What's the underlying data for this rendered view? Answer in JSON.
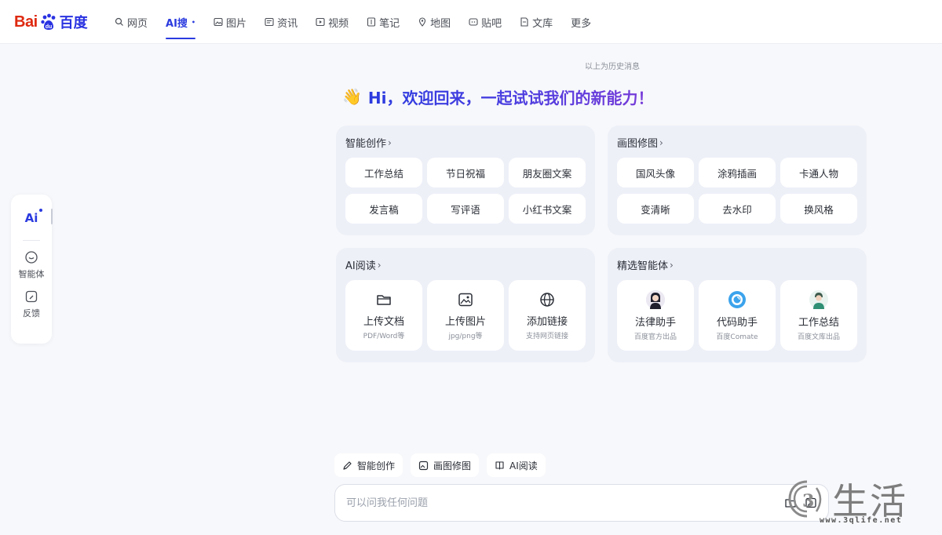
{
  "logo": {
    "left": "Bai",
    "right": "百度"
  },
  "nav": [
    {
      "label": "网页",
      "icon": "search-icon"
    },
    {
      "label": "AI搜",
      "icon": "",
      "sup": "•",
      "active": true
    },
    {
      "label": "图片",
      "icon": "image-icon"
    },
    {
      "label": "资讯",
      "icon": "news-icon"
    },
    {
      "label": "视频",
      "icon": "video-icon"
    },
    {
      "label": "笔记",
      "icon": "note-icon"
    },
    {
      "label": "地图",
      "icon": "map-icon"
    },
    {
      "label": "贴吧",
      "icon": "tieba-icon"
    },
    {
      "label": "文库",
      "icon": "doc-icon"
    },
    {
      "label": "更多",
      "icon": ""
    }
  ],
  "rail": {
    "ai_label": "Ai",
    "agents_label": "智能体",
    "feedback_label": "反馈"
  },
  "history_link": "以上为历史消息",
  "greeting": {
    "emoji": "👋",
    "text": "Hi，欢迎回来，一起试试我们的新能力！"
  },
  "panels": {
    "creation": {
      "title": "智能创作",
      "items": [
        "工作总结",
        "节日祝福",
        "朋友圈文案",
        "发言稿",
        "写评语",
        "小红书文案"
      ]
    },
    "drawing": {
      "title": "画图修图",
      "items": [
        "国风头像",
        "涂鸦插画",
        "卡通人物",
        "变清晰",
        "去水印",
        "换风格"
      ]
    },
    "reading": {
      "title": "AI阅读",
      "cards": [
        {
          "title": "上传文档",
          "sub": "PDF/Word等",
          "icon": "folder-icon"
        },
        {
          "title": "上传图片",
          "sub": "jpg/png等",
          "icon": "image-icon"
        },
        {
          "title": "添加链接",
          "sub": "支持网页链接",
          "icon": "globe-icon"
        }
      ]
    },
    "agents": {
      "title": "精选智能体",
      "cards": [
        {
          "title": "法律助手",
          "sub": "百度官方出品",
          "icon": "lawyer-avatar"
        },
        {
          "title": "代码助手",
          "sub": "百度Comate",
          "icon": "comate-avatar"
        },
        {
          "title": "工作总结",
          "sub": "百度文库出品",
          "icon": "worker-avatar"
        }
      ]
    }
  },
  "quick_actions": [
    {
      "label": "智能创作",
      "icon": "pen-icon"
    },
    {
      "label": "画图修图",
      "icon": "picture-icon"
    },
    {
      "label": "AI阅读",
      "icon": "book-icon"
    }
  ],
  "input": {
    "placeholder": "可以问我任何问题"
  },
  "watermark": {
    "text": "生活",
    "url": "www.3qlife.net"
  }
}
